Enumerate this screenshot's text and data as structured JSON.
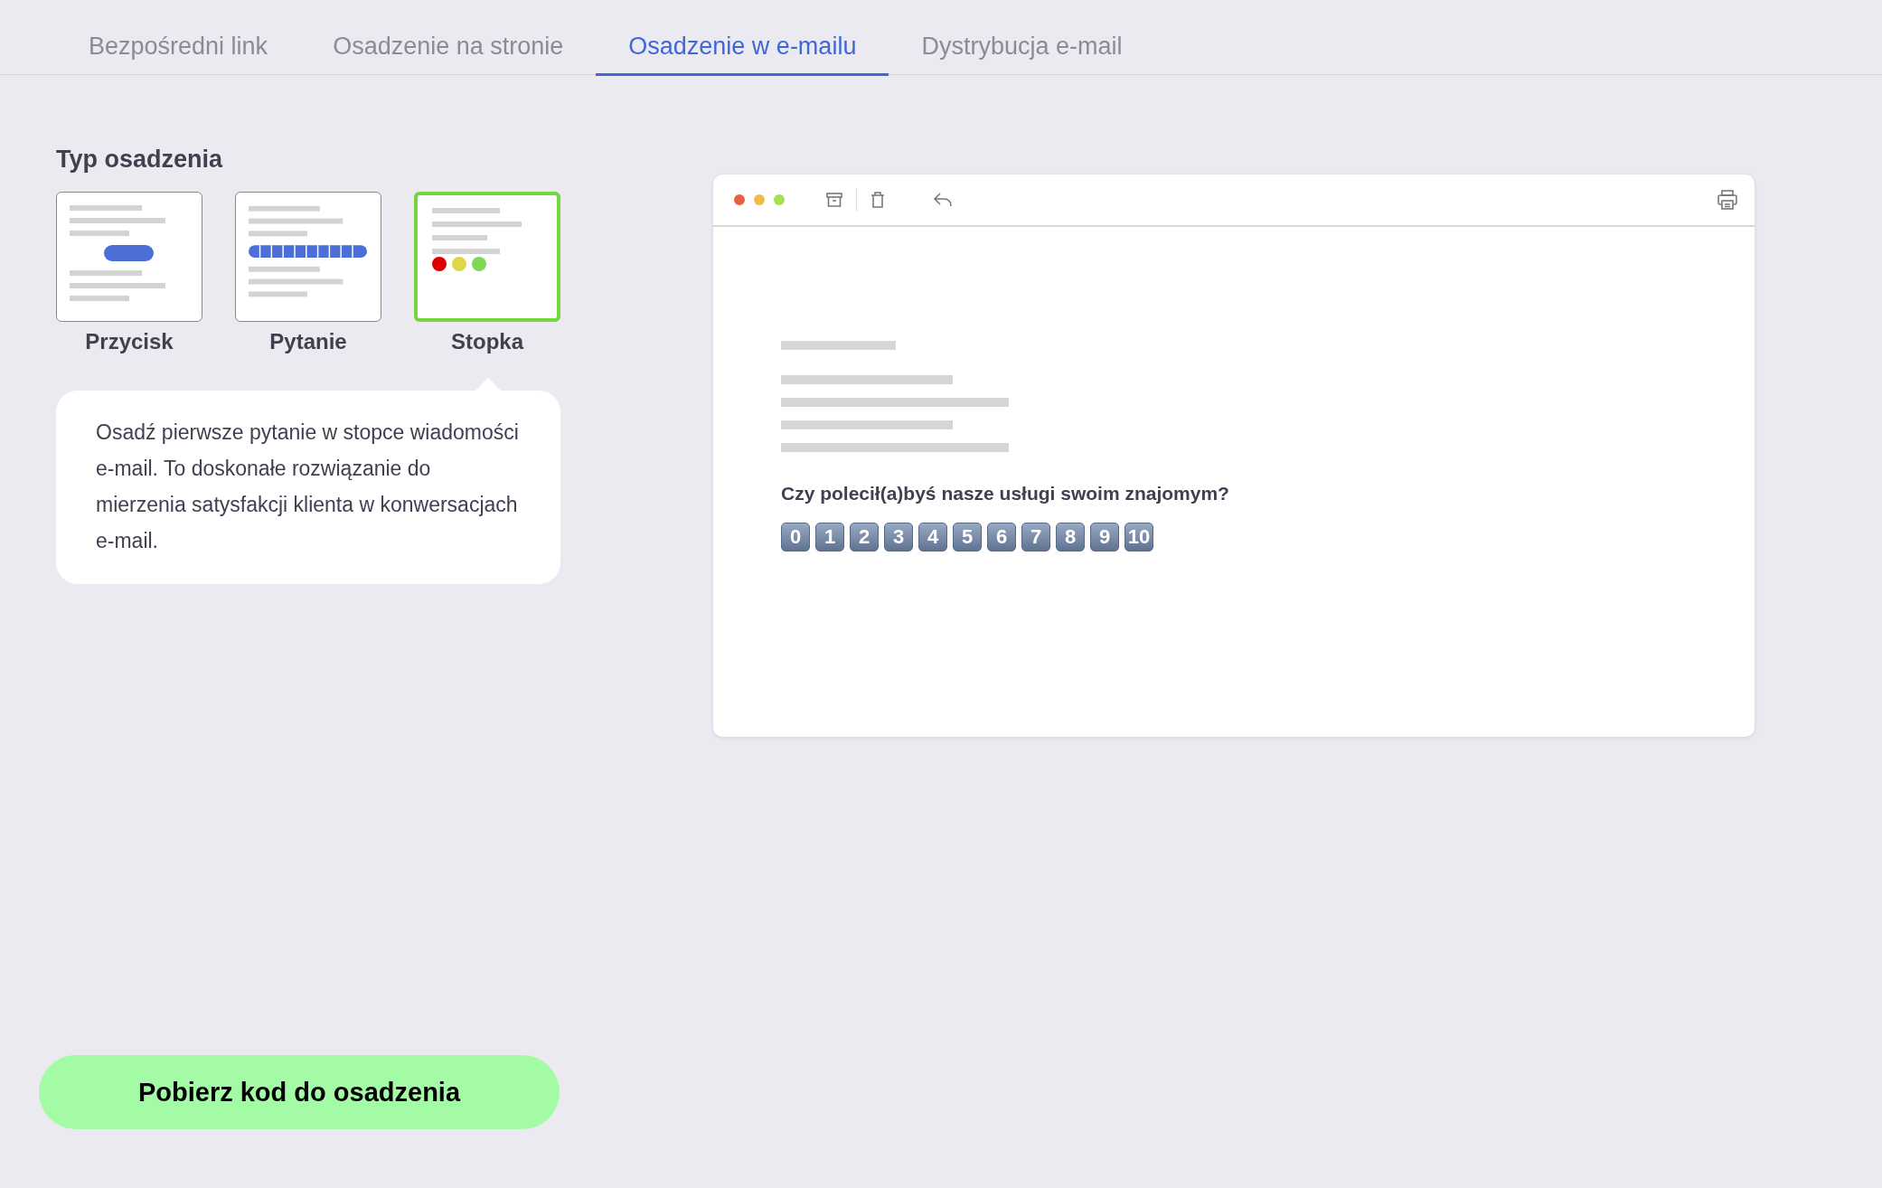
{
  "tabs": [
    {
      "label": "Bezpośredni link",
      "selected": false
    },
    {
      "label": "Osadzenie na stronie",
      "selected": false
    },
    {
      "label": "Osadzenie w e-mailu",
      "selected": true
    },
    {
      "label": "Dystrybucja e-mail",
      "selected": false
    }
  ],
  "embed_type": {
    "heading": "Typ osadzenia",
    "options": [
      {
        "label": "Przycisk",
        "kind": "button",
        "selected": false
      },
      {
        "label": "Pytanie",
        "kind": "question",
        "selected": false
      },
      {
        "label": "Stopka",
        "kind": "footer",
        "selected": true
      }
    ],
    "description": "Osadź pierwsze pytanie w stopce wiadomości e-mail. To doskonałe rozwiązanie do mierzenia satysfakcji klienta w konwersacjach e-mail."
  },
  "email_preview": {
    "question": "Czy polecił(a)byś nasze usługi swoim znajomym?",
    "scale": [
      "0",
      "1",
      "2",
      "3",
      "4",
      "5",
      "6",
      "7",
      "8",
      "9",
      "10"
    ]
  },
  "get_code_button": "Pobierz kod do osadzenia"
}
